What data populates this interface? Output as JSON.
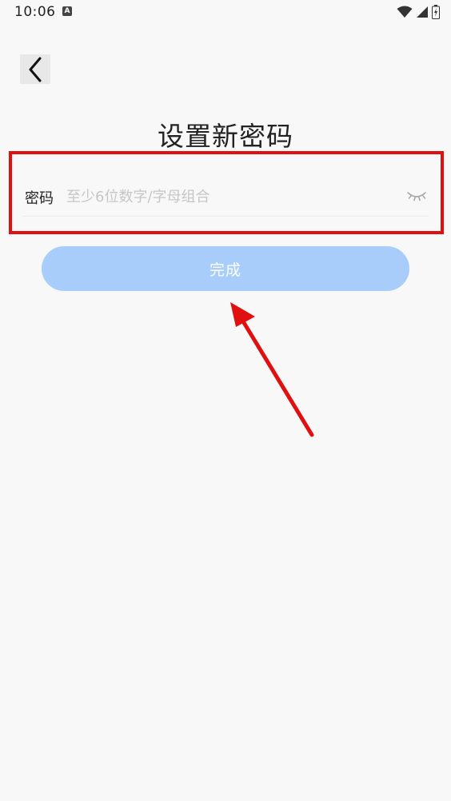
{
  "status_bar": {
    "time": "10:06",
    "notification_icon": "A"
  },
  "header": {
    "back_icon": "chevron-left-icon"
  },
  "title": "设置新密码",
  "password_field": {
    "label": "密码",
    "value": "",
    "placeholder": "至少6位数字/字母组合",
    "toggle_icon": "eye-closed-icon"
  },
  "submit_button": {
    "label": "完成"
  },
  "colors": {
    "background": "#f8f8f8",
    "button": "#a9cdfb",
    "highlight": "#e01010",
    "placeholder": "#c6c6c6"
  }
}
